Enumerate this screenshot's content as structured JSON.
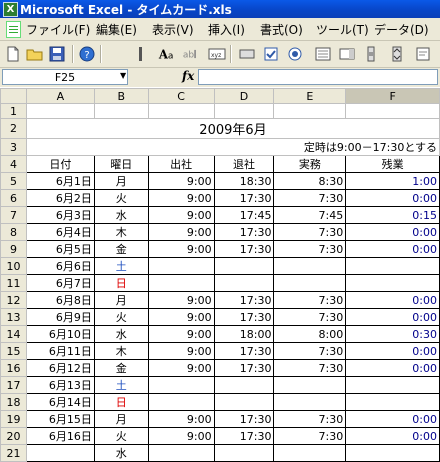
{
  "window": {
    "app_icon_letter": "X",
    "title": "Microsoft Excel - タイムカード.xls"
  },
  "menu": [
    "ファイル(F)",
    "編集(E)",
    "表示(V)",
    "挿入(I)",
    "書式(O)",
    "ツール(T)",
    "データ(D)"
  ],
  "toolbar_icons": [
    "new-file-icon",
    "open-folder-icon",
    "save-icon",
    "help-icon",
    "font-size-icon",
    "text-field-icon",
    "label-icon",
    "button-icon",
    "checkbox-icon",
    "radio-icon"
  ],
  "name_box": "F25",
  "fx_label": "fx",
  "columns": [
    "A",
    "B",
    "C",
    "D",
    "E",
    "F"
  ],
  "sheet": {
    "title": "2009年6月",
    "note": "定時は9:00－17:30とする",
    "headers": [
      "日付",
      "曜日",
      "出社",
      "退社",
      "実務",
      "残業"
    ],
    "rows": [
      {
        "row": "5",
        "date": "6月1日",
        "wd": "月",
        "wd_type": "weekday",
        "in": "9:00",
        "out": "18:30",
        "work": "8:30",
        "ot": "1:00"
      },
      {
        "row": "6",
        "date": "6月2日",
        "wd": "火",
        "wd_type": "weekday",
        "in": "9:00",
        "out": "17:30",
        "work": "7:30",
        "ot": "0:00"
      },
      {
        "row": "7",
        "date": "6月3日",
        "wd": "水",
        "wd_type": "weekday",
        "in": "9:00",
        "out": "17:45",
        "work": "7:45",
        "ot": "0:15"
      },
      {
        "row": "8",
        "date": "6月4日",
        "wd": "木",
        "wd_type": "weekday",
        "in": "9:00",
        "out": "17:30",
        "work": "7:30",
        "ot": "0:00"
      },
      {
        "row": "9",
        "date": "6月5日",
        "wd": "金",
        "wd_type": "weekday",
        "in": "9:00",
        "out": "17:30",
        "work": "7:30",
        "ot": "0:00"
      },
      {
        "row": "10",
        "date": "6月6日",
        "wd": "土",
        "wd_type": "sat",
        "in": "",
        "out": "",
        "work": "",
        "ot": ""
      },
      {
        "row": "11",
        "date": "6月7日",
        "wd": "日",
        "wd_type": "sun",
        "in": "",
        "out": "",
        "work": "",
        "ot": ""
      },
      {
        "row": "12",
        "date": "6月8日",
        "wd": "月",
        "wd_type": "weekday",
        "in": "9:00",
        "out": "17:30",
        "work": "7:30",
        "ot": "0:00"
      },
      {
        "row": "13",
        "date": "6月9日",
        "wd": "火",
        "wd_type": "weekday",
        "in": "9:00",
        "out": "17:30",
        "work": "7:30",
        "ot": "0:00"
      },
      {
        "row": "14",
        "date": "6月10日",
        "wd": "水",
        "wd_type": "weekday",
        "in": "9:00",
        "out": "18:00",
        "work": "8:00",
        "ot": "0:30"
      },
      {
        "row": "15",
        "date": "6月11日",
        "wd": "木",
        "wd_type": "weekday",
        "in": "9:00",
        "out": "17:30",
        "work": "7:30",
        "ot": "0:00"
      },
      {
        "row": "16",
        "date": "6月12日",
        "wd": "金",
        "wd_type": "weekday",
        "in": "9:00",
        "out": "17:30",
        "work": "7:30",
        "ot": "0:00"
      },
      {
        "row": "17",
        "date": "6月13日",
        "wd": "土",
        "wd_type": "sat",
        "in": "",
        "out": "",
        "work": "",
        "ot": ""
      },
      {
        "row": "18",
        "date": "6月14日",
        "wd": "日",
        "wd_type": "sun",
        "in": "",
        "out": "",
        "work": "",
        "ot": ""
      },
      {
        "row": "19",
        "date": "6月15日",
        "wd": "月",
        "wd_type": "weekday",
        "in": "9:00",
        "out": "17:30",
        "work": "7:30",
        "ot": "0:00"
      },
      {
        "row": "20",
        "date": "6月16日",
        "wd": "火",
        "wd_type": "weekday",
        "in": "9:00",
        "out": "17:30",
        "work": "7:30",
        "ot": "0:00"
      },
      {
        "row": "21",
        "date": "",
        "wd": "水",
        "wd_type": "weekday",
        "in": "",
        "out": "",
        "work": "",
        "ot": ""
      }
    ]
  },
  "colors": {
    "saturday": "#1f4fbf",
    "sunday": "#dd0000",
    "overtime": "#00008b"
  }
}
